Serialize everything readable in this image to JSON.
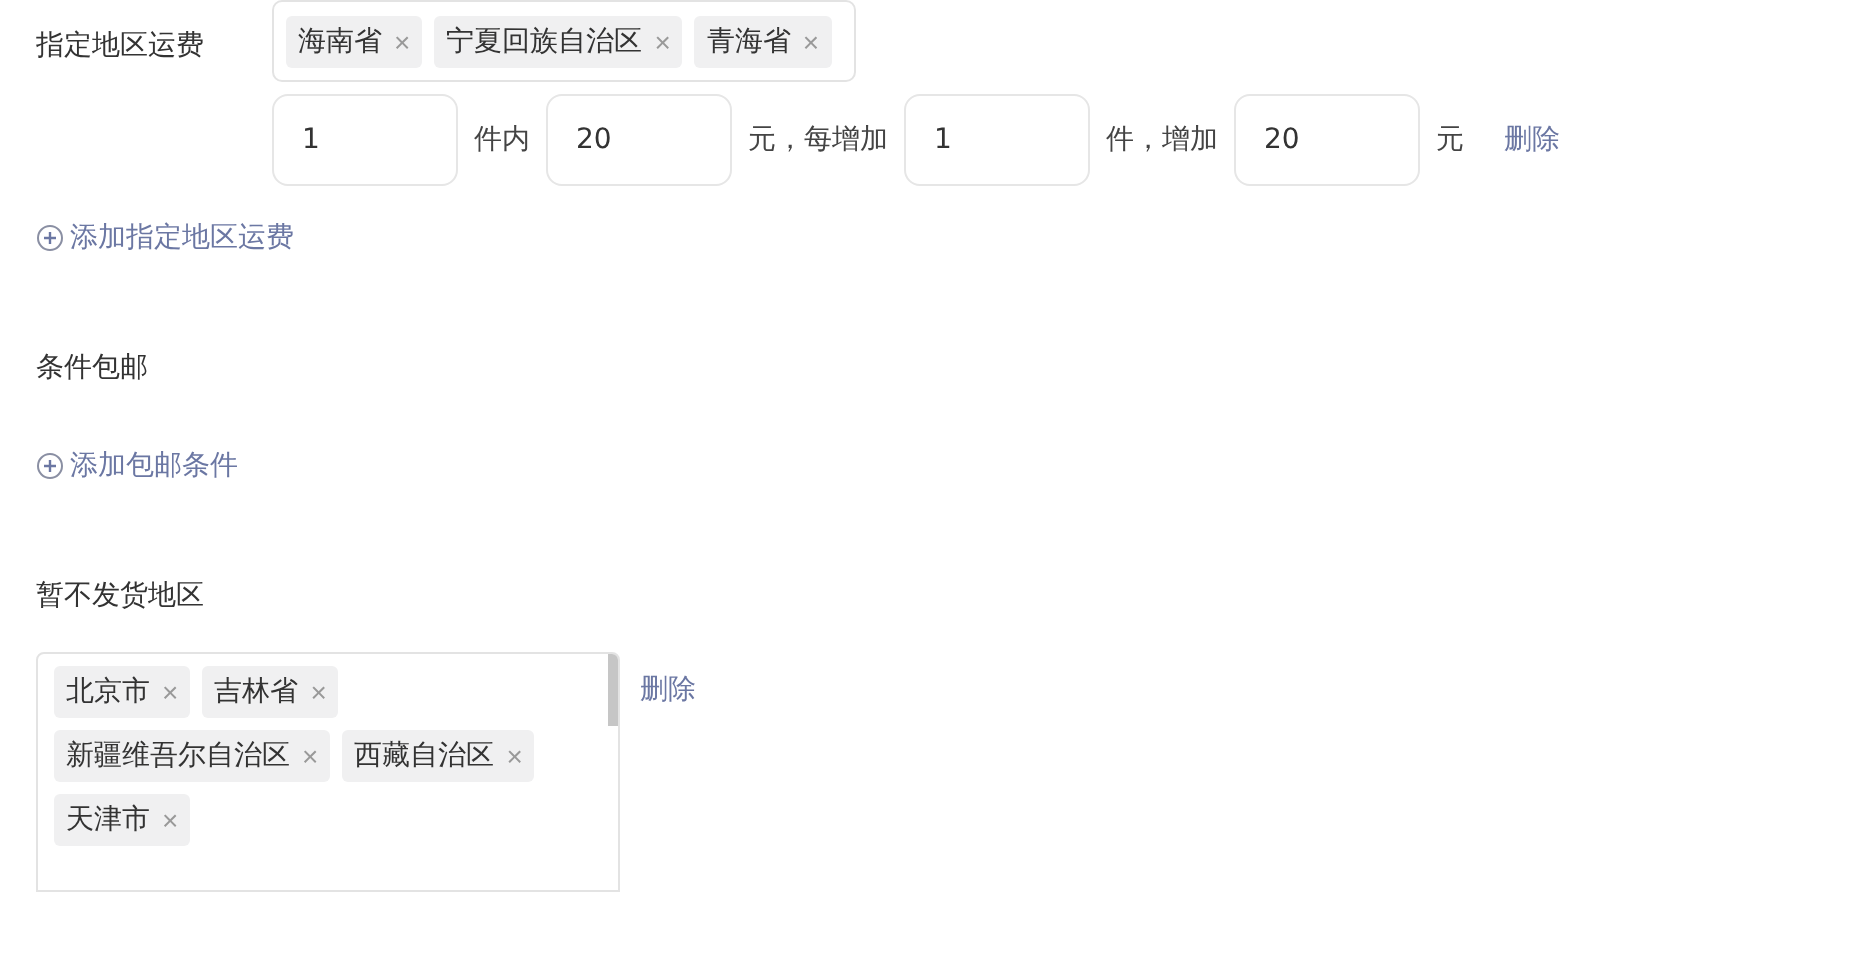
{
  "region_fee": {
    "label": "指定地区运费",
    "regions": [
      {
        "name": "海南省",
        "remove": "×"
      },
      {
        "name": "宁夏回族自治区",
        "remove": "×"
      },
      {
        "name": "青海省",
        "remove": "×"
      }
    ],
    "rule": [
      {
        "kind": "input",
        "value": "1"
      },
      {
        "kind": "text",
        "text": "件内"
      },
      {
        "kind": "input",
        "value": "20"
      },
      {
        "kind": "text",
        "text": "元，每增加"
      },
      {
        "kind": "input",
        "value": "1"
      },
      {
        "kind": "text",
        "text": "件，增加"
      },
      {
        "kind": "input",
        "value": "20"
      },
      {
        "kind": "text",
        "text": "元"
      },
      {
        "kind": "link",
        "text": "删除"
      }
    ],
    "add_link": "添加指定地区运费"
  },
  "free_shipping": {
    "label": "条件包邮",
    "add_link": "添加包邮条件"
  },
  "no_delivery": {
    "label": "暂不发货地区",
    "regions": [
      {
        "name": "北京市",
        "remove": "×"
      },
      {
        "name": "吉林省",
        "remove": "×"
      },
      {
        "name": "新疆维吾尔自治区",
        "remove": "×"
      },
      {
        "name": "西藏自治区",
        "remove": "×"
      },
      {
        "name": "天津市",
        "remove": "×"
      }
    ],
    "delete": "删除"
  }
}
